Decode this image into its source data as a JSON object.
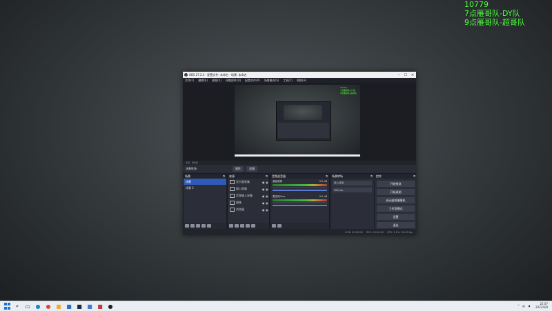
{
  "overlay": {
    "line1": "10779",
    "line2": "7点雁哥队-DY队",
    "line3": "9点雁哥队-超哥队"
  },
  "window": {
    "title": "OBS 27.2.4 - 配置文件: 未命名 - 场景: 未命名",
    "minimize": "–",
    "maximize": "☐",
    "close": "✕"
  },
  "menu": [
    "文件(F)",
    "编辑(E)",
    "视图(V)",
    "停靠部件(D)",
    "配置文件(P)",
    "场景集合(S)",
    "工具(T)",
    "帮助(H)"
  ],
  "preview_status": "无源 · 场景源",
  "controls_row": {
    "label": "场景转场",
    "properties": "属性",
    "filters": "滤镜"
  },
  "docks": {
    "scenes": {
      "title": "场景",
      "items": [
        "场景",
        "场景 2"
      ]
    },
    "sources": {
      "title": "来源",
      "items": [
        "显示器采集",
        "窗口采集",
        "音频输入采集",
        "图像",
        "浏览器"
      ]
    },
    "mixer": {
      "title": "音频混音器",
      "tracks": [
        {
          "name": "桌面音频",
          "db": "0.0 dB"
        },
        {
          "name": "麦克风/Aux",
          "db": "0.0 dB"
        }
      ]
    },
    "transitions": {
      "title": "场景转场",
      "selected": "淡入淡出",
      "duration": "300 ms"
    },
    "controls": {
      "title": "控件",
      "buttons": [
        "开始推流",
        "开始录制",
        "启动虚拟摄像机",
        "工作室模式",
        "设置",
        "退出"
      ]
    }
  },
  "bottom_status": {
    "live": "LIVE: 00:00:00",
    "rec": "REC: 00:00:00",
    "cpu": "CPU: 1.2%, 30.00 fps"
  },
  "taskbar": {
    "icons": [
      "start-icon",
      "search-icon",
      "task-view-icon",
      "edge-icon",
      "chrome-icon",
      "folder-icon",
      "mail-icon",
      "steam-icon",
      "store-icon",
      "app-icon",
      "obs-icon"
    ],
    "time": "22:07",
    "date": "2022/6/8"
  },
  "colors": {
    "overlay": "#4cff3a",
    "selection": "#2e5ab8",
    "obs_bg": "#272a33"
  }
}
